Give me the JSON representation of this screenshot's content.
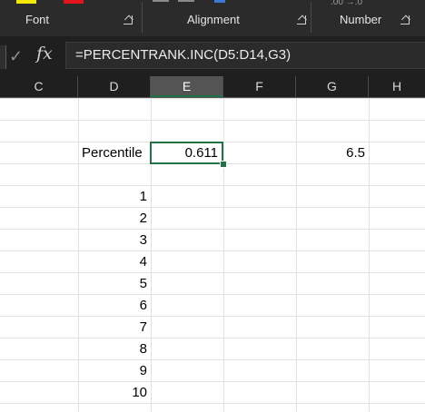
{
  "ribbon": {
    "groups": [
      {
        "label": "Font"
      },
      {
        "label": "Alignment"
      },
      {
        "label": "Number"
      }
    ],
    "number_format_hint": ".00  →.0"
  },
  "formula_bar": {
    "formula": "=PERCENTRANK.INC(D5:D14,G3)",
    "fx_symbol": "fx",
    "cancel_symbol": "✓"
  },
  "columns": [
    "C",
    "D",
    "E",
    "F",
    "G",
    "H"
  ],
  "selected_column": "E",
  "cells": {
    "D3": "Percentile",
    "E3": "0.611",
    "G3": "6.5",
    "data_list": [
      "1",
      "2",
      "3",
      "4",
      "5",
      "6",
      "7",
      "8",
      "9",
      "10"
    ]
  },
  "colors": {
    "selection": "#217346",
    "ribbon_bg": "#2b2b2b"
  }
}
